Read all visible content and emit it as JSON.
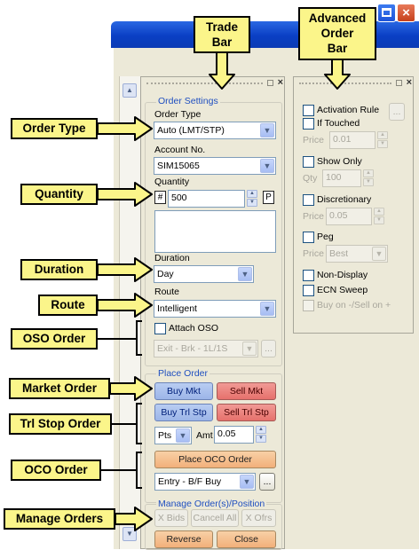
{
  "callouts": {
    "trade_bar": "Trade\nBar",
    "advanced_order_bar": "Advanced\nOrder\nBar",
    "order_type": "Order Type",
    "quantity": "Quantity",
    "duration": "Duration",
    "route": "Route",
    "oso_order": "OSO Order",
    "market_order": "Market Order",
    "trl_stop_order": "Trl Stop Order",
    "oco_order": "OCO Order",
    "manage_orders": "Manage Orders"
  },
  "window": {
    "close_glyph": "×",
    "panel_close_glyph": "×"
  },
  "trade_bar": {
    "order_settings": {
      "title": "Order Settings",
      "order_type_label": "Order Type",
      "order_type_value": "Auto (LMT/STP)",
      "account_label": "Account No.",
      "account_value": "SIM15065",
      "quantity_label": "Quantity",
      "quantity_hash": "#",
      "quantity_value": "500",
      "quantity_p": "P",
      "duration_label": "Duration",
      "duration_value": "Day",
      "route_label": "Route",
      "route_value": "Intelligent",
      "attach_oso_label": "Attach OSO",
      "oso_value": "Exit - Brk - 1L/1S",
      "oso_more": "..."
    },
    "place_order": {
      "title": "Place Order",
      "buy_mkt": "Buy Mkt",
      "sell_mkt": "Sell Mkt",
      "buy_trl_stp": "Buy Trl Stp",
      "sell_trl_stp": "Sell Trl Stp",
      "trail_unit": "Pts",
      "amt_label": "Amt",
      "amt_value": "0.05",
      "place_oco": "Place OCO Order",
      "oco_value": "Entry - B/F Buy",
      "oco_more": "..."
    },
    "manage": {
      "title": "Manage Order(s)/Position",
      "x_bids": "X Bids",
      "cancel_all": "Cancell All",
      "x_ofrs": "X Ofrs",
      "reverse": "Reverse",
      "close": "Close"
    }
  },
  "advanced_bar": {
    "activation_rule": "Activation Rule",
    "activation_more": "...",
    "if_touched": "If Touched",
    "price_label": "Price",
    "price_value": "0.01",
    "show_only": "Show Only",
    "qty_label": "Qty",
    "qty_value": "100",
    "discretionary": "Discretionary",
    "disc_price_label": "Price",
    "disc_price_value": "0.05",
    "peg": "Peg",
    "peg_price_label": "Price",
    "peg_price_value": "Best",
    "non_display": "Non-Display",
    "ecn_sweep": "ECN Sweep",
    "buy_on_sell_on": "Buy on -/Sell on +"
  }
}
